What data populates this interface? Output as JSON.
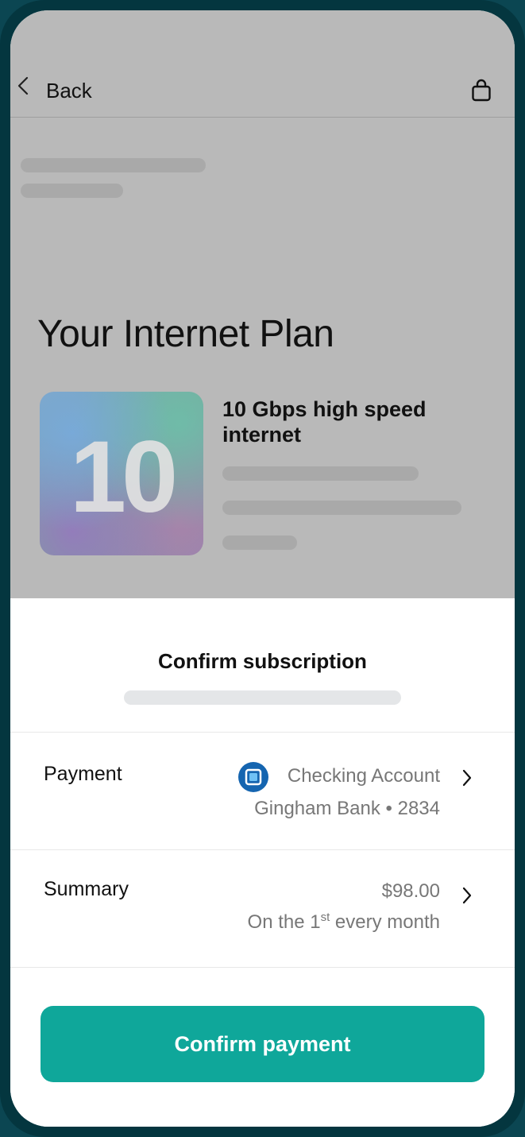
{
  "header": {
    "back_label": "Back"
  },
  "plan": {
    "title": "Your Internet Plan",
    "tile_number": "10",
    "name": "10 Gbps high speed internet"
  },
  "sheet": {
    "title": "Confirm subscription",
    "payment": {
      "label": "Payment",
      "account": "Checking Account",
      "bank_detail": "Gingham Bank • 2834"
    },
    "summary": {
      "label": "Summary",
      "amount": "$98.00",
      "schedule_prefix": "On the 1",
      "schedule_sup": "st",
      "schedule_suffix": " every month"
    },
    "confirm_button": "Confirm payment"
  },
  "icons": {
    "back": "chevron-left-icon",
    "bag": "shopping-bag-icon",
    "bank": "bank-icon",
    "chevron": "chevron-right-icon"
  },
  "colors": {
    "accent": "#0fa79a",
    "bank_icon": "#1565b0",
    "overlay": "#b9b9b9"
  }
}
